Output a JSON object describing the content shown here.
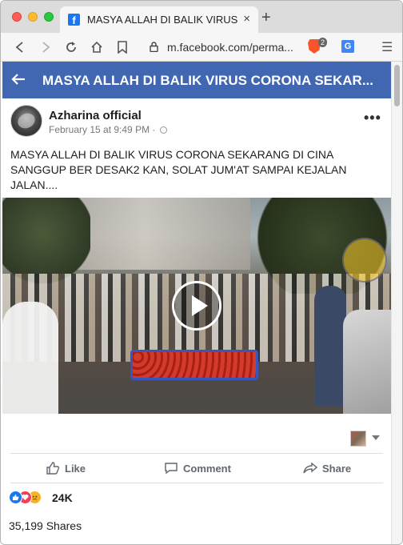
{
  "browser": {
    "tab_title": "MASYA ALLAH DI BALIK VIRUS CO",
    "tab_close": "×",
    "new_tab": "+",
    "url": "m.facebook.com/perma...",
    "brave_badge": "2",
    "translate_icon": "G"
  },
  "header": {
    "title": "MASYA ALLAH DI BALIK VIRUS CORONA SEKAR..."
  },
  "post": {
    "author": "Azharina official",
    "timestamp": "February 15 at 9:49 PM",
    "separator": "·",
    "more": "•••",
    "text": "MASYA ALLAH DI BALIK VIRUS CORONA SEKARANG DI CINA SANGGUP BER DESAK2 KAN, SOLAT JUM'AT SAMPAI KEJALAN JALAN...."
  },
  "actions": {
    "like": "Like",
    "comment": "Comment",
    "share": "Share"
  },
  "stats": {
    "reactions_count": "24K",
    "shares": "35,199 Shares"
  },
  "colors": {
    "facebook_blue": "#4267b2",
    "like_blue": "#1877f2",
    "love_red": "#f33e58",
    "sad_yellow": "#f7b125"
  }
}
